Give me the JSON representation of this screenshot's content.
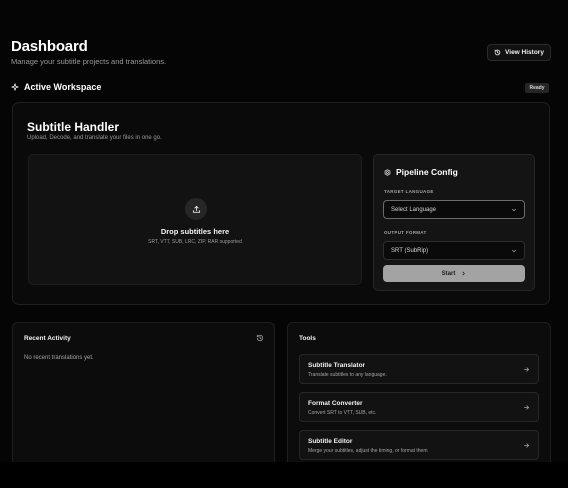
{
  "header": {
    "title": "Dashboard",
    "subtitle": "Manage your subtitle projects and translations.",
    "history_button": "View History"
  },
  "workspace": {
    "title": "Active Workspace",
    "status": "Ready"
  },
  "handler": {
    "title": "Subtitle Handler",
    "subtitle": "Upload, Decode, and translate your files in one go.",
    "dropzone": {
      "title": "Drop subtitles here",
      "formats": "SRT, VTT, SUB, LRC, ZIP, RAR supported"
    }
  },
  "pipeline": {
    "title": "Pipeline Config",
    "target_label": "TARGET LANGUAGE",
    "target_value": "Select Language",
    "format_label": "OUTPUT FORMAT",
    "format_value": "SRT (SubRip)",
    "start_label": "Start"
  },
  "recent": {
    "title": "Recent Activity",
    "empty": "No recent translations yet."
  },
  "tools": {
    "title": "Tools",
    "items": [
      {
        "name": "Subtitle Translator",
        "desc": "Translate subtitles to any language."
      },
      {
        "name": "Format Converter",
        "desc": "Convert SRT to VTT, SUB, etc."
      },
      {
        "name": "Subtitle Editor",
        "desc": "Merge your subtitles, adjust the timing, or format them"
      }
    ]
  },
  "colors": {
    "background": "#050505",
    "card": "#0a0a0a",
    "accent_button": "#a3a3a3",
    "text": "#ffffff",
    "muted": "#9a9a9a"
  },
  "icons": {
    "history": "history-icon",
    "workspace": "sparkle-icon",
    "upload": "upload-icon",
    "pipeline": "settings-icon",
    "chevron": "chevron-down-icon",
    "arrow": "arrow-right-icon"
  }
}
